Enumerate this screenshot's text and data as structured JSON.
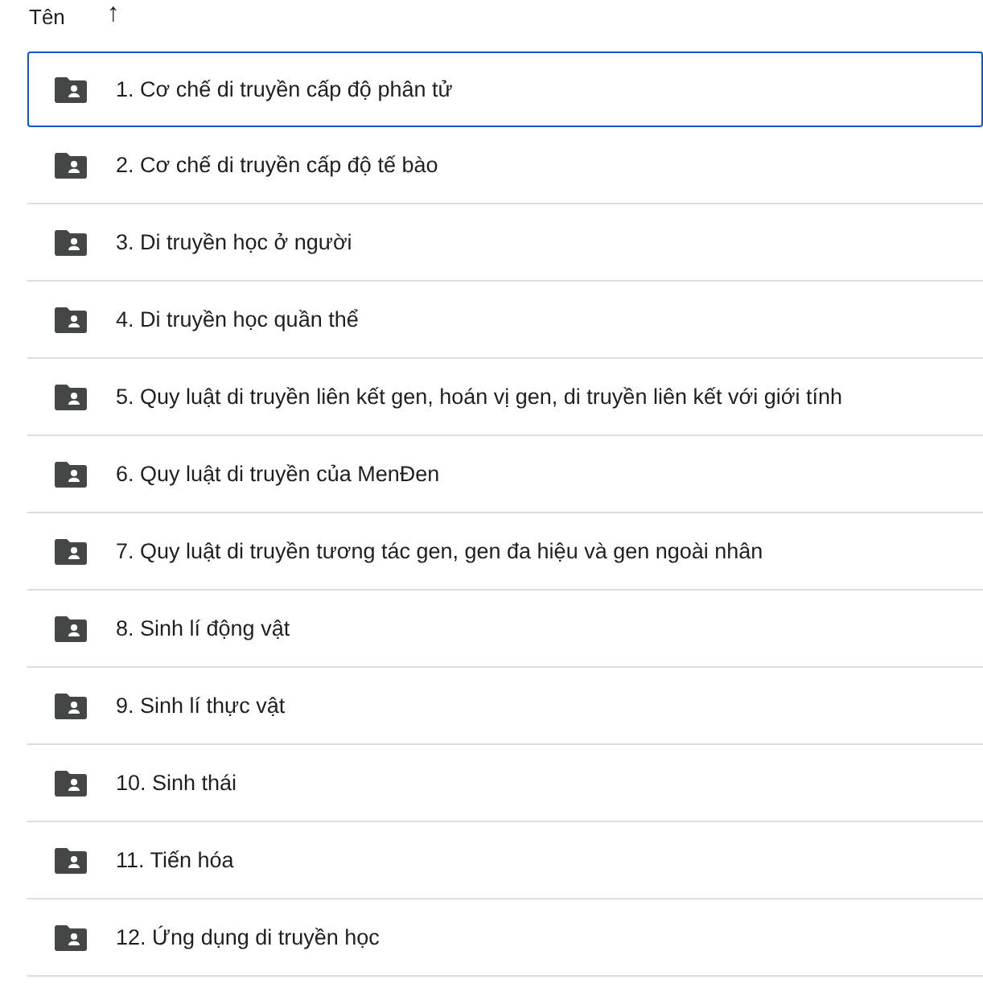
{
  "header": {
    "label": "Tên",
    "sort_icon": "↑"
  },
  "rows": [
    {
      "name": "1. Cơ chế di truyền cấp độ phân tử",
      "selected": true
    },
    {
      "name": "2. Cơ chế di truyền cấp độ tế bào",
      "selected": false
    },
    {
      "name": "3. Di truyền học ở người",
      "selected": false
    },
    {
      "name": "4. Di truyền học quần thể",
      "selected": false
    },
    {
      "name": "5. Quy luật di truyền liên kết gen, hoán vị gen, di truyền liên kết với giới tính",
      "selected": false
    },
    {
      "name": "6. Quy luật di truyền của MenĐen",
      "selected": false
    },
    {
      "name": "7. Quy luật di truyền tương tác gen, gen đa hiệu và gen ngoài nhân",
      "selected": false
    },
    {
      "name": "8. Sinh lí động vật",
      "selected": false
    },
    {
      "name": "9. Sinh lí thực vật",
      "selected": false
    },
    {
      "name": "10. Sinh thái",
      "selected": false
    },
    {
      "name": "11. Tiến hóa",
      "selected": false
    },
    {
      "name": "12. Ứng dụng di truyền học",
      "selected": false
    }
  ]
}
